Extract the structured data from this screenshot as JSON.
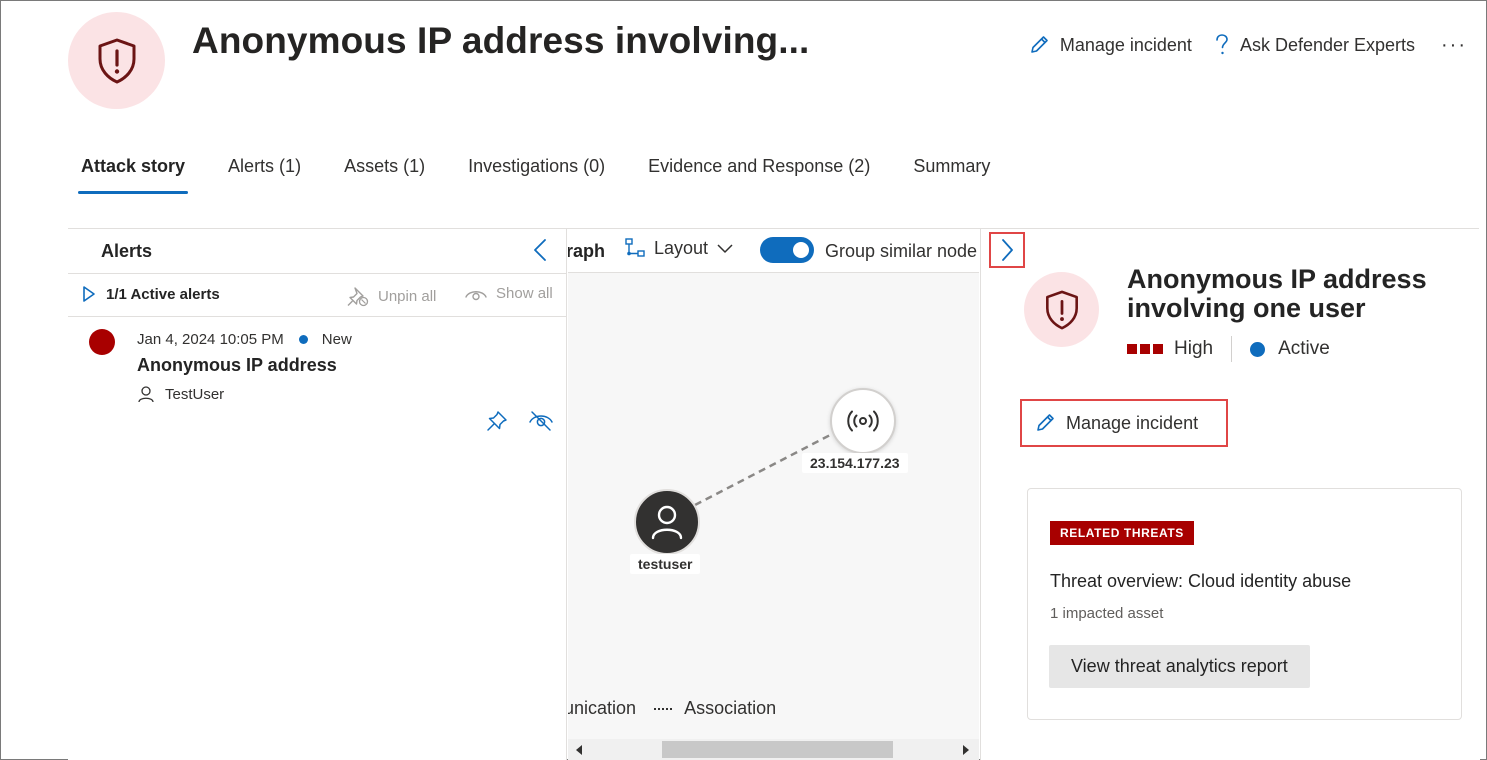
{
  "header": {
    "title": "Anonymous IP address involving...",
    "icon": "shield-alert-icon",
    "actions": {
      "manage_incident": "Manage incident",
      "ask_experts": "Ask Defender Experts",
      "more": "···"
    }
  },
  "tabs": [
    {
      "label": "Attack story",
      "active": true
    },
    {
      "label": "Alerts (1)",
      "active": false
    },
    {
      "label": "Assets (1)",
      "active": false
    },
    {
      "label": "Investigations (0)",
      "active": false
    },
    {
      "label": "Evidence and Response (2)",
      "active": false
    },
    {
      "label": "Summary",
      "active": false
    }
  ],
  "alerts_panel": {
    "title": "Alerts",
    "active_count": "1/1 Active alerts",
    "unpin_all": "Unpin all",
    "show_all": "Show all",
    "alerts": [
      {
        "date": "Jan 4, 2024 10:05 PM",
        "status": "New",
        "name": "Anonymous IP address",
        "user": "TestUser",
        "severity_color": "#a80000"
      }
    ]
  },
  "graph": {
    "view_label": "raph",
    "layout_label": "Layout",
    "group_similar_label": "Group similar node",
    "group_similar_on": true,
    "nodes": {
      "ip": "23.154.177.23",
      "user": "testuser"
    },
    "legend": {
      "communication": "unication",
      "association": "Association"
    }
  },
  "details_panel": {
    "title": "Anonymous IP address involving one user",
    "severity": "High",
    "status": "Active",
    "manage_incident": "Manage incident",
    "related_threats": {
      "badge": "RELATED THREATS",
      "name": "Threat overview: Cloud identity abuse",
      "impact": "1 impacted asset",
      "button": "View threat analytics report"
    }
  },
  "colors": {
    "accent": "#0f6cbd",
    "severity_high": "#a80000",
    "highlight_border": "#e04646",
    "icon_bg": "#fbe3e5"
  }
}
